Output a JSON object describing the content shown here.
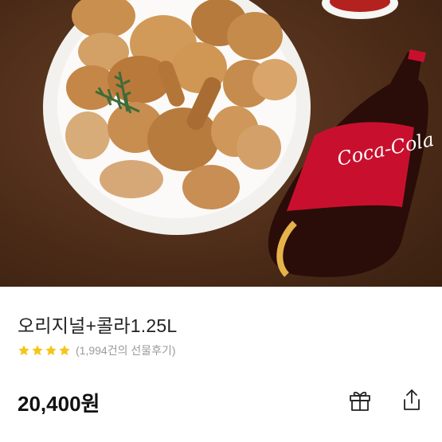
{
  "product": {
    "image_alt": "오리지널+콜라1.25L",
    "bottle_logo": "Coca-Cola",
    "title": "오리지널+콜라1.25L",
    "rating_stars": 4,
    "review_text": "(1,994건의 선물후기)",
    "price": "20,400원"
  },
  "actions": {
    "gift_icon": "gift-icon",
    "share_icon": "share-icon"
  },
  "colors": {
    "background_brown": "#4e2d19",
    "star_yellow": "#f5c518",
    "cola_red": "#c8102e",
    "text_dark": "#222222",
    "text_gray": "#9a9a9a"
  }
}
